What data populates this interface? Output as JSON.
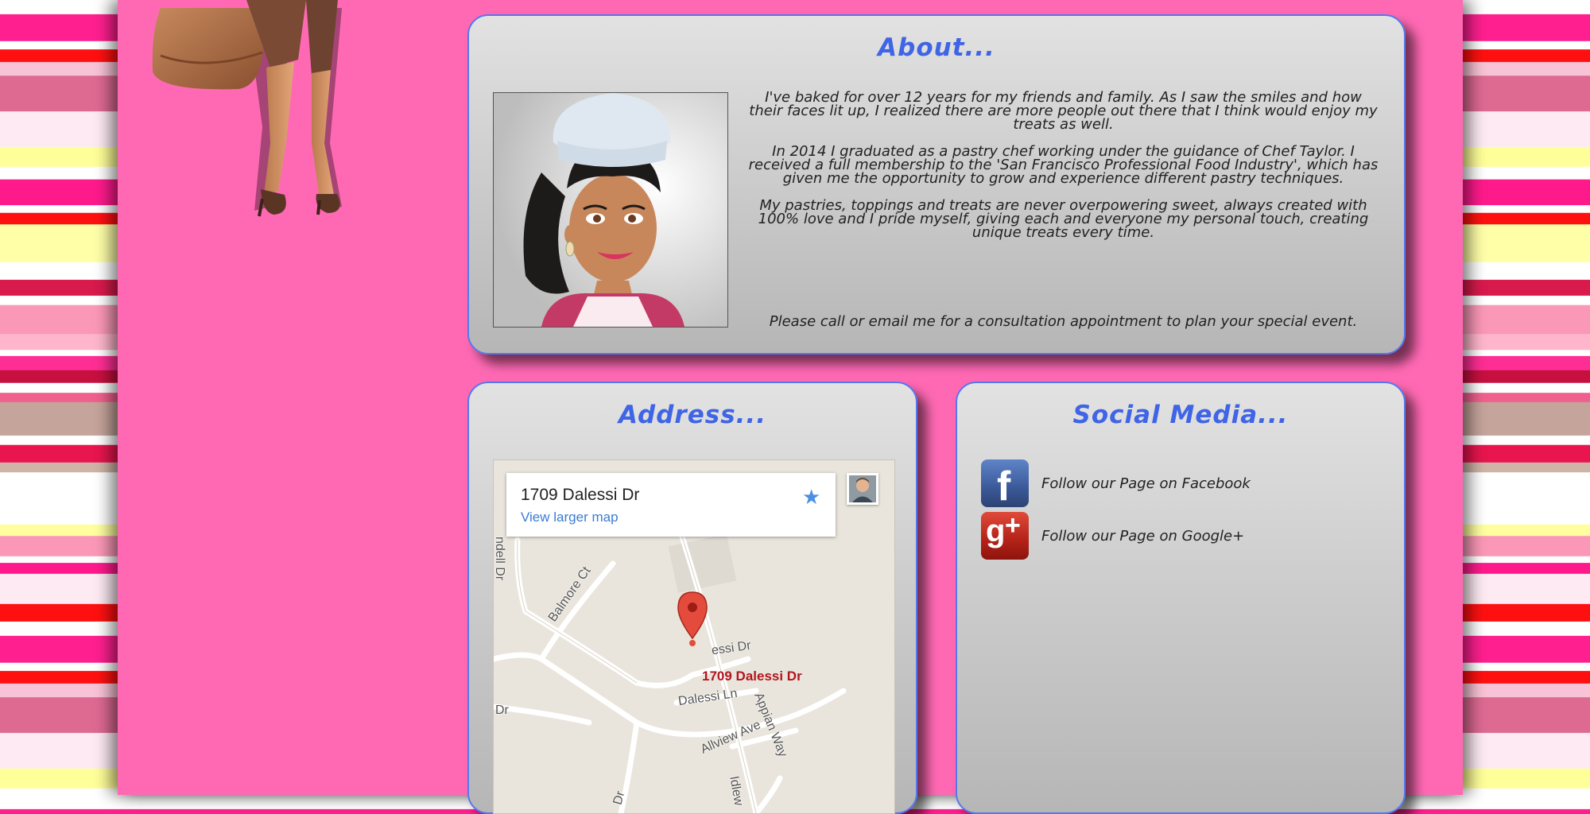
{
  "about": {
    "title": "About...",
    "paragraphs": [
      "I've baked for over 12 years for my friends and family. As I saw the smiles and how their faces lit up, I realized there are more people out there that I think would enjoy my treats as well.",
      "In 2014 I graduated as a pastry chef working under the guidance of Chef Taylor. I received a full membership to the 'San Francisco Professional Food Industry', which has given me the opportunity to grow and experience different pastry techniques.",
      "My pastries, toppings and treats are never overpowering sweet, always created with 100% love and I pride myself, giving each and everyone my personal touch, creating unique treats every time."
    ],
    "call_to_action": "Please call or email me for a consultation appointment to plan your special event."
  },
  "address": {
    "title": "Address...",
    "map": {
      "card_address": "1709 Dalessi Dr",
      "view_larger": "View larger map",
      "marker_label": "1709 Dalessi Dr",
      "roads": {
        "balmore": "Balmore Ct",
        "dalessi_dr": "essi Dr",
        "dalessi_ln": "Dalessi Ln",
        "allview": "Allview Ave",
        "appian": "Appian Way",
        "ndell": "ndell Dr",
        "dr_left": "Dr",
        "dr_bottom": "Dr",
        "idlew": "Idlew"
      }
    }
  },
  "social": {
    "title": "Social Media...",
    "items": [
      {
        "icon": "facebook-icon",
        "label": "Follow our Page on Facebook"
      },
      {
        "icon": "google-plus-icon",
        "label": "Follow our Page on Google+"
      }
    ]
  },
  "colors": {
    "page_bg": "#ff69b4",
    "title": "#3f64e6",
    "panel_border": "#5577ee"
  }
}
